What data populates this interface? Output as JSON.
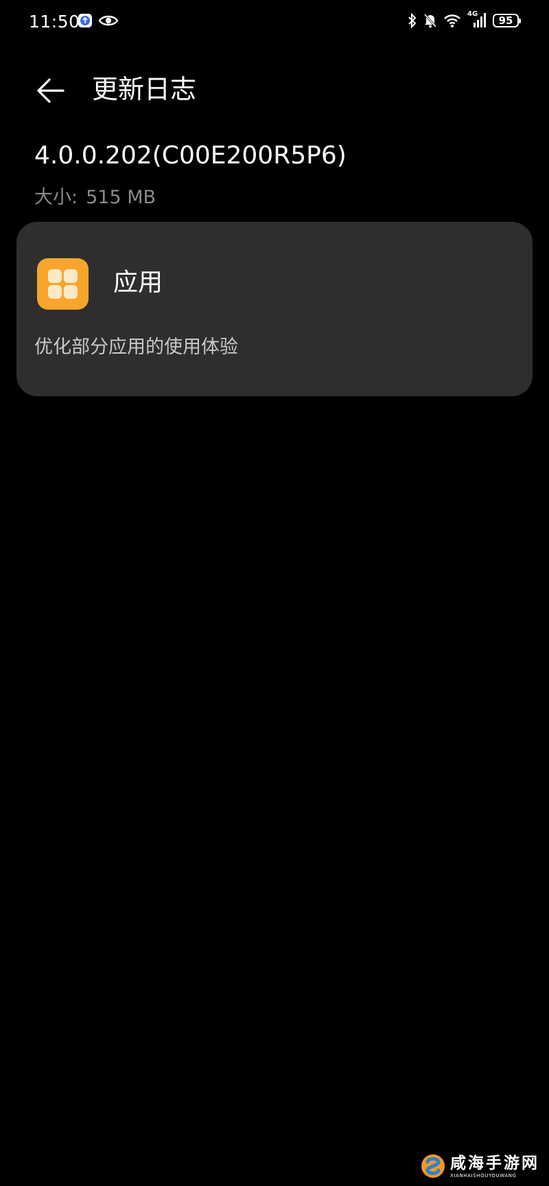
{
  "status_bar": {
    "time": "11:50",
    "battery": "95",
    "network": "4G",
    "icons": [
      "app-notification-icon",
      "eye-icon",
      "bluetooth-icon",
      "bell-off-icon",
      "wifi-icon",
      "signal-icon",
      "battery-icon"
    ]
  },
  "header": {
    "title": "更新日志",
    "back_icon": "arrow-left-icon"
  },
  "update": {
    "version": "4.0.0.202(C00E200R5P6)",
    "size_label": "大小:",
    "size_value": "515 MB"
  },
  "card": {
    "icon": "apps-grid-icon",
    "title": "应用",
    "description": "优化部分应用的使用体验"
  },
  "watermark": {
    "main": "咸海手游网",
    "sub": "XIANHAISHOUYOUWANG"
  },
  "colors": {
    "background": "#000000",
    "card": "#2e2e2e",
    "accent": "#f7a52c",
    "secondary_text": "#8a8a8a"
  }
}
